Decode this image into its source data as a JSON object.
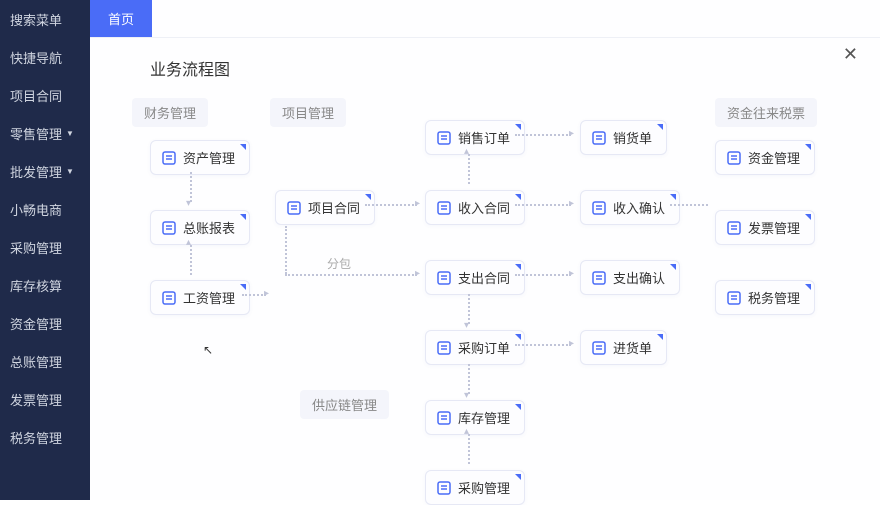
{
  "sidebar": {
    "items": [
      {
        "label": "搜索菜单",
        "chev": false
      },
      {
        "label": "快捷导航",
        "chev": false
      },
      {
        "label": "项目合同",
        "chev": false
      },
      {
        "label": "零售管理",
        "chev": true
      },
      {
        "label": "批发管理",
        "chev": true
      },
      {
        "label": "小畅电商",
        "chev": false
      },
      {
        "label": "采购管理",
        "chev": false
      },
      {
        "label": "库存核算",
        "chev": false
      },
      {
        "label": "资金管理",
        "chev": false
      },
      {
        "label": "总账管理",
        "chev": false
      },
      {
        "label": "发票管理",
        "chev": false
      },
      {
        "label": "税务管理",
        "chev": false
      }
    ]
  },
  "tabs": [
    {
      "label": "首页",
      "active": true
    }
  ],
  "content": {
    "title": "业务流程图",
    "close": "✕"
  },
  "diagram": {
    "section_labels": {
      "finance": "财务管理",
      "project": "项目管理",
      "funds_tax": "资金往来税票",
      "supply": "供应链管理"
    },
    "subcontract_label": "分包",
    "nodes": {
      "asset_mgmt": "资产管理",
      "ledger_report": "总账报表",
      "salary_mgmt": "工资管理",
      "project_contract": "项目合同",
      "sales_order": "销售订单",
      "income_contract": "收入合同",
      "expense_contract": "支出合同",
      "purchase_order": "采购订单",
      "inventory_mgmt": "库存管理",
      "purchase_mgmt": "采购管理",
      "delivery_note": "销货单",
      "income_confirm": "收入确认",
      "expense_confirm": "支出确认",
      "receipt_note": "进货单",
      "fund_mgmt": "资金管理",
      "invoice_mgmt": "发票管理",
      "tax_mgmt": "税务管理"
    }
  },
  "icons": {
    "doc": "#4a6cf7"
  }
}
